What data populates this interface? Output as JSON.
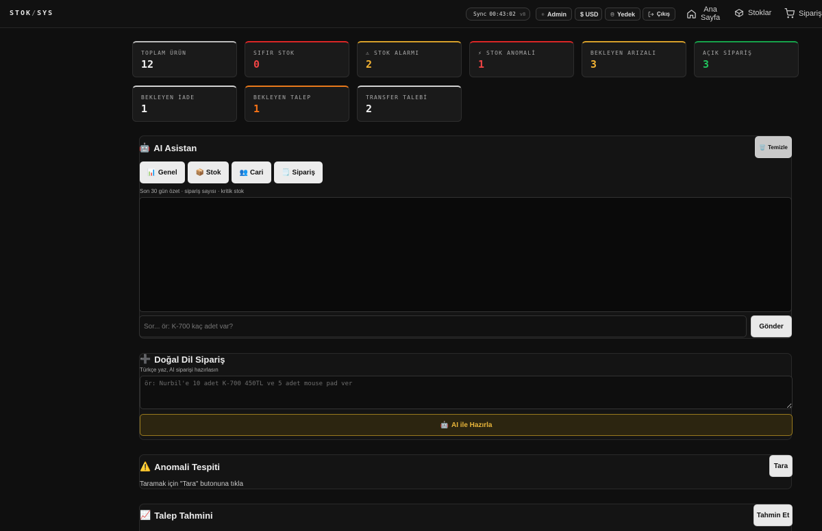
{
  "header": {
    "logo_left": "STOK",
    "logo_sep": "/",
    "logo_right": "SYS",
    "sync_label": "Sync",
    "sync_time": "00:43:02",
    "sync_version": "v8",
    "admin_label": "Admin",
    "currency_label": "$ USD",
    "backup_label": "Yedek",
    "logout_label": "Çıkış",
    "nav": [
      {
        "label": "Ana Sayfa",
        "label_line1": "Ana",
        "label_line2": "Sayfa"
      },
      {
        "label": "Stoklar"
      },
      {
        "label": "Sipariş"
      }
    ]
  },
  "stats": [
    {
      "label": "TOPLAM ÜRÜN",
      "value": "12",
      "color": "#f0f0f0",
      "accent": "#bdbdbd"
    },
    {
      "label": "SIFIR STOK",
      "value": "0",
      "color": "#ef4444",
      "accent": "#dc2626"
    },
    {
      "label": "⚠ STOK ALARMI",
      "value": "2",
      "color": "#f2b233",
      "accent": "#d9a12a"
    },
    {
      "label": "⚡ STOK ANOMALİ",
      "value": "1",
      "color": "#ef4444",
      "accent": "#dc2626"
    },
    {
      "label": "BEKLEYEN ARIZALI",
      "value": "3",
      "color": "#f2b233",
      "accent": "#d9a12a"
    },
    {
      "label": "AÇIK SİPARİŞ",
      "value": "3",
      "color": "#22c55e",
      "accent": "#16a34a"
    },
    {
      "label": "BEKLEYEN İADE",
      "value": "1",
      "color": "#f0f0f0",
      "accent": "#d4d4d4"
    },
    {
      "label": "BEKLEYEN TALEP",
      "value": "1",
      "color": "#f97316",
      "accent": "#ea7a1c"
    },
    {
      "label": "TRANSFER TALEBİ",
      "value": "2",
      "color": "#f0f0f0",
      "accent": "#d4d4d4"
    }
  ],
  "ai_assistant": {
    "icon": "🤖",
    "title": "AI Asistan",
    "clear_icon": "🗑️",
    "clear_label": "Temizle",
    "quick_buttons": [
      {
        "icon": "📊",
        "label": "Genel"
      },
      {
        "icon": "📦",
        "label": "Stok"
      },
      {
        "icon": "👥",
        "label": "Cari"
      },
      {
        "icon": "🗒️",
        "label": "Sipariş"
      }
    ],
    "hint": "Son 30 gün özet · sipariş sayısı · kritik stok",
    "input_placeholder": "Sor... ör: K-700 kaç adet var?",
    "send_label": "Gönder"
  },
  "nl_order": {
    "icon": "➕",
    "title": "Doğal Dil Sipariş",
    "subtitle": "Türkçe yaz, AI siparişi hazırlasın",
    "placeholder": "ör: Nurbil'e 10 adet K-700 450TL ve 5 adet mouse pad ver",
    "button_icon": "🤖",
    "button_label": "AI ile Hazırla"
  },
  "anomaly": {
    "icon": "⚠️",
    "title": "Anomali Tespiti",
    "scan_label": "Tara",
    "message": "Taramak için \"Tara\" butonuna tıkla"
  },
  "forecast": {
    "icon": "📈",
    "title": "Talep Tahmini",
    "button_label": "Tahmin Et"
  }
}
